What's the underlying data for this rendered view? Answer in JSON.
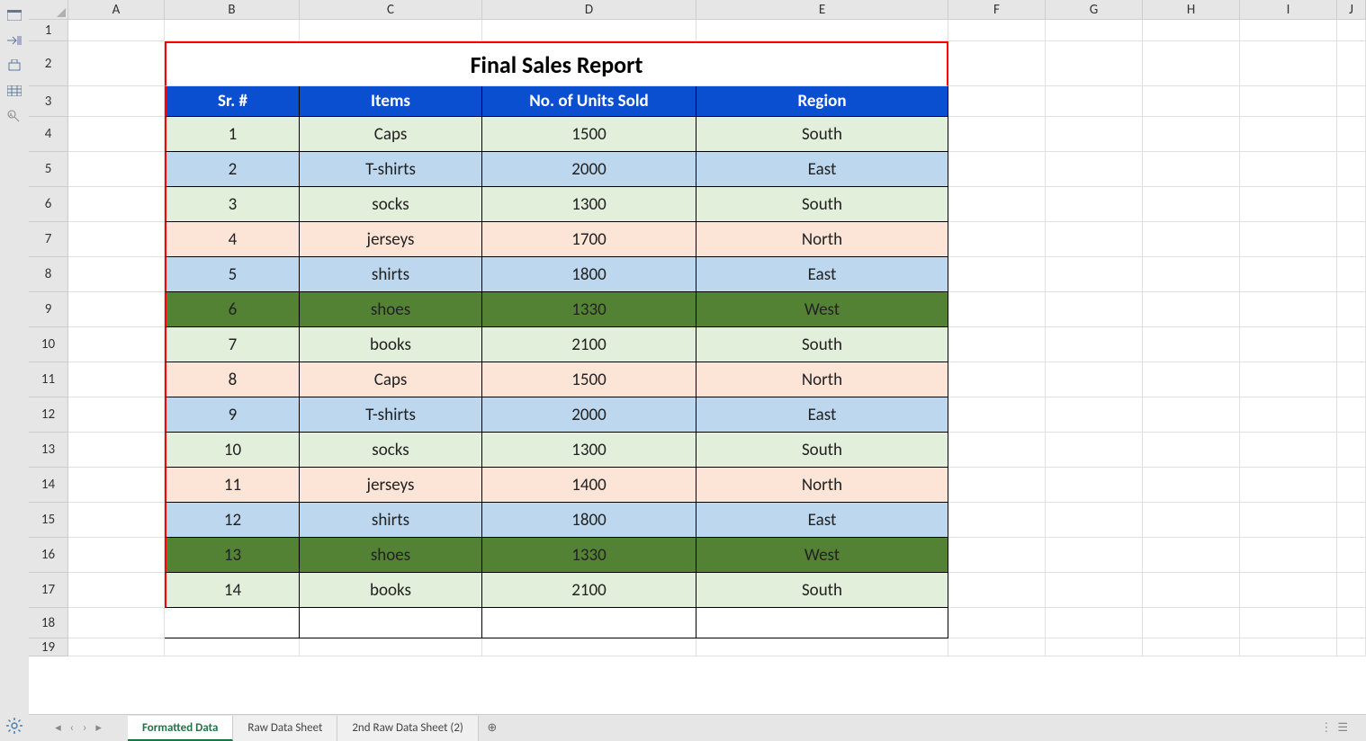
{
  "columns": [
    "A",
    "B",
    "C",
    "D",
    "E",
    "F",
    "G",
    "H",
    "I",
    "J"
  ],
  "title": "Final Sales Report",
  "headers": {
    "sr": "Sr. #",
    "items": "Items",
    "units": "No. of Units Sold",
    "region": "Region"
  },
  "rows": [
    {
      "sr": "1",
      "item": "Caps",
      "units": "1500",
      "region": "South",
      "bg": "bg-lg"
    },
    {
      "sr": "2",
      "item": "T-shirts",
      "units": "2000",
      "region": "East",
      "bg": "bg-lb"
    },
    {
      "sr": "3",
      "item": "socks",
      "units": "1300",
      "region": "South",
      "bg": "bg-lg"
    },
    {
      "sr": "4",
      "item": "jerseys",
      "units": "1700",
      "region": "North",
      "bg": "bg-lp"
    },
    {
      "sr": "5",
      "item": "shirts",
      "units": "1800",
      "region": "East",
      "bg": "bg-lb"
    },
    {
      "sr": "6",
      "item": "shoes",
      "units": "1330",
      "region": "West",
      "bg": "bg-dg"
    },
    {
      "sr": "7",
      "item": "books",
      "units": "2100",
      "region": "South",
      "bg": "bg-lg"
    },
    {
      "sr": "8",
      "item": "Caps",
      "units": "1500",
      "region": "North",
      "bg": "bg-lp"
    },
    {
      "sr": "9",
      "item": "T-shirts",
      "units": "2000",
      "region": "East",
      "bg": "bg-lb"
    },
    {
      "sr": "10",
      "item": "socks",
      "units": "1300",
      "region": "South",
      "bg": "bg-lg"
    },
    {
      "sr": "11",
      "item": "jerseys",
      "units": "1400",
      "region": "North",
      "bg": "bg-lp"
    },
    {
      "sr": "12",
      "item": "shirts",
      "units": "1800",
      "region": "East",
      "bg": "bg-lb"
    },
    {
      "sr": "13",
      "item": "shoes",
      "units": "1330",
      "region": "West",
      "bg": "bg-dg"
    },
    {
      "sr": "14",
      "item": "books",
      "units": "2100",
      "region": "South",
      "bg": "bg-lg"
    }
  ],
  "tabs": [
    {
      "label": "Formatted Data",
      "active": true
    },
    {
      "label": "Raw Data Sheet",
      "active": false
    },
    {
      "label": "2nd Raw Data Sheet  (2)",
      "active": false
    }
  ],
  "row_heights": {
    "1": 24,
    "2": 50,
    "3": 34,
    "data": 39,
    "18": 34,
    "19": 20
  },
  "chart_data": {
    "type": "table",
    "title": "Final Sales Report",
    "columns": [
      "Sr. #",
      "Items",
      "No. of Units Sold",
      "Region"
    ],
    "rows": [
      [
        1,
        "Caps",
        1500,
        "South"
      ],
      [
        2,
        "T-shirts",
        2000,
        "East"
      ],
      [
        3,
        "socks",
        1300,
        "South"
      ],
      [
        4,
        "jerseys",
        1700,
        "North"
      ],
      [
        5,
        "shirts",
        1800,
        "East"
      ],
      [
        6,
        "shoes",
        1330,
        "West"
      ],
      [
        7,
        "books",
        2100,
        "South"
      ],
      [
        8,
        "Caps",
        1500,
        "North"
      ],
      [
        9,
        "T-shirts",
        2000,
        "East"
      ],
      [
        10,
        "socks",
        1300,
        "South"
      ],
      [
        11,
        "jerseys",
        1400,
        "North"
      ],
      [
        12,
        "shirts",
        1800,
        "East"
      ],
      [
        13,
        "shoes",
        1330,
        "West"
      ],
      [
        14,
        "books",
        2100,
        "South"
      ]
    ]
  }
}
